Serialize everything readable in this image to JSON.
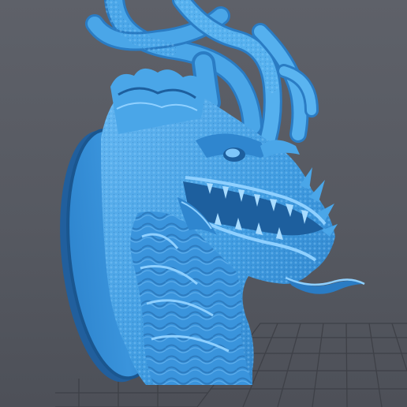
{
  "viewport": {
    "background_color": "#575a62",
    "grid_color": "#3e4047",
    "model_color": "#3f9be0",
    "model_highlight_color": "#8fd0ff",
    "model_shadow_color": "#1d5f9e",
    "model_name": "dragon-bust-on-oval-plaque"
  }
}
